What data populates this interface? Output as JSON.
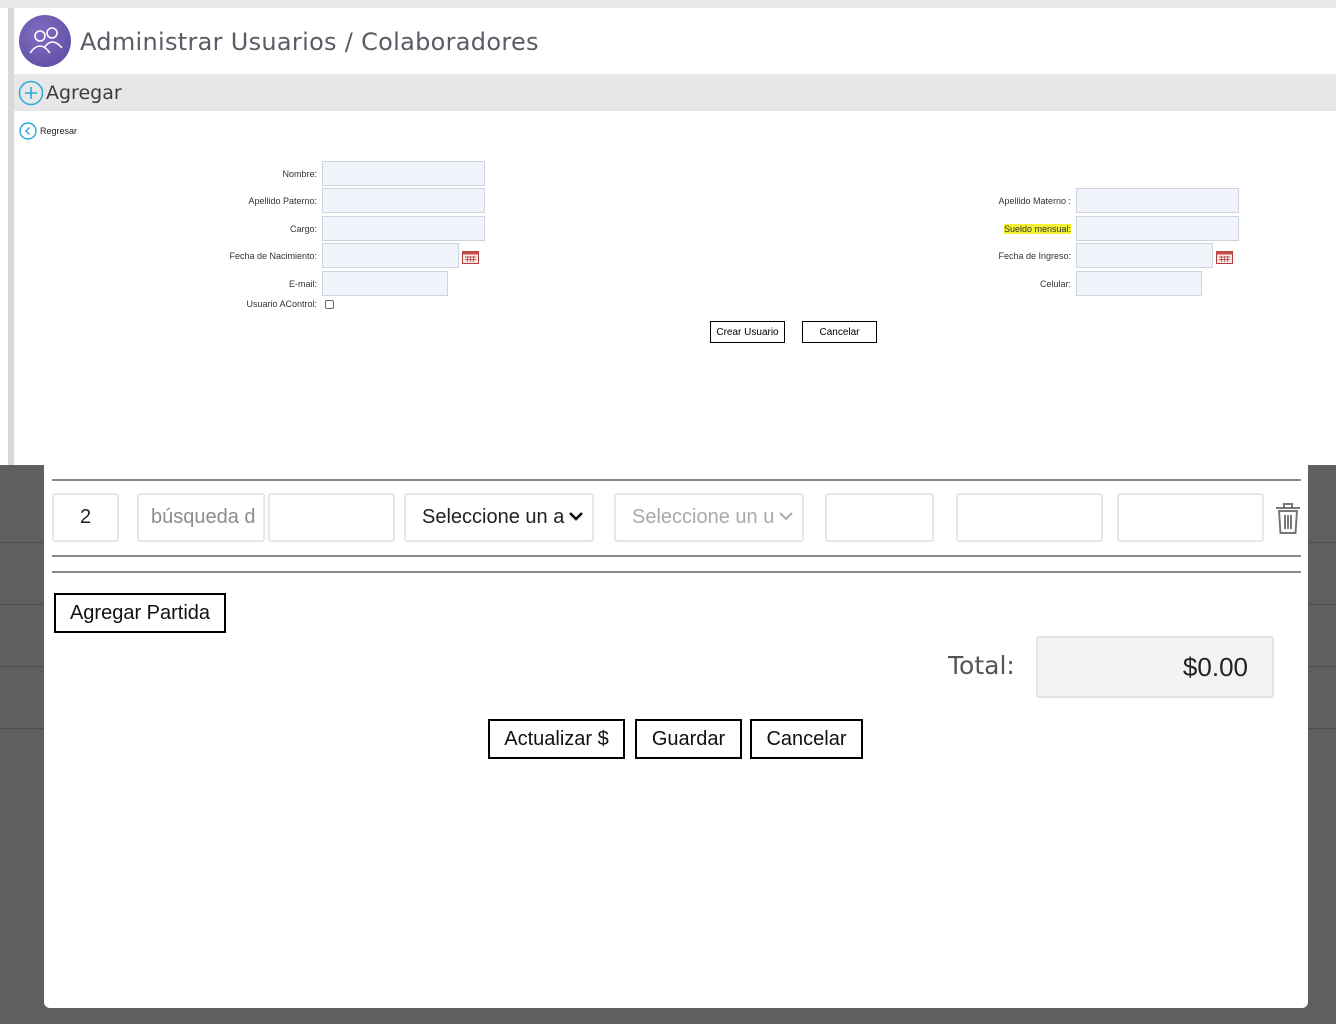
{
  "header": {
    "title": "Administrar Usuarios / Colaboradores",
    "add_label": "Agregar",
    "back_label": "Regresar"
  },
  "form": {
    "left": {
      "nombre": "Nombre:",
      "apellido_paterno": "Apellido Paterno:",
      "cargo": "Cargo:",
      "fecha_nacimiento": "Fecha de Nacimiento:",
      "email": "E-mail:",
      "usuario_acontrol": "Usuario AControl:"
    },
    "right": {
      "apellido_materno": "Apellido Materno :",
      "sueldo_mensual": "Sueldo mensual:",
      "fecha_ingreso": "Fecha de Ingreso:",
      "celular": "Celular:"
    },
    "usuario_acontrol_checked": false,
    "buttons": {
      "crear": "Crear Usuario",
      "cancelar": "Cancelar"
    }
  },
  "partida": {
    "row": {
      "number": "2",
      "search_placeholder": "búsqueda d",
      "select1": "Seleccione un a",
      "select2": "Seleccione un u"
    },
    "agregar_label": "Agregar Partida",
    "total_label": "Total:",
    "total_value": "$0.00",
    "buttons": {
      "actualizar": "Actualizar $",
      "guardar": "Guardar",
      "cancelar": "Cancelar"
    }
  },
  "colors": {
    "avatar": "#6a5ab4",
    "highlight": "#f4f132",
    "field_bg": "#f1f4fb",
    "overlay": "#5f5f5f"
  }
}
